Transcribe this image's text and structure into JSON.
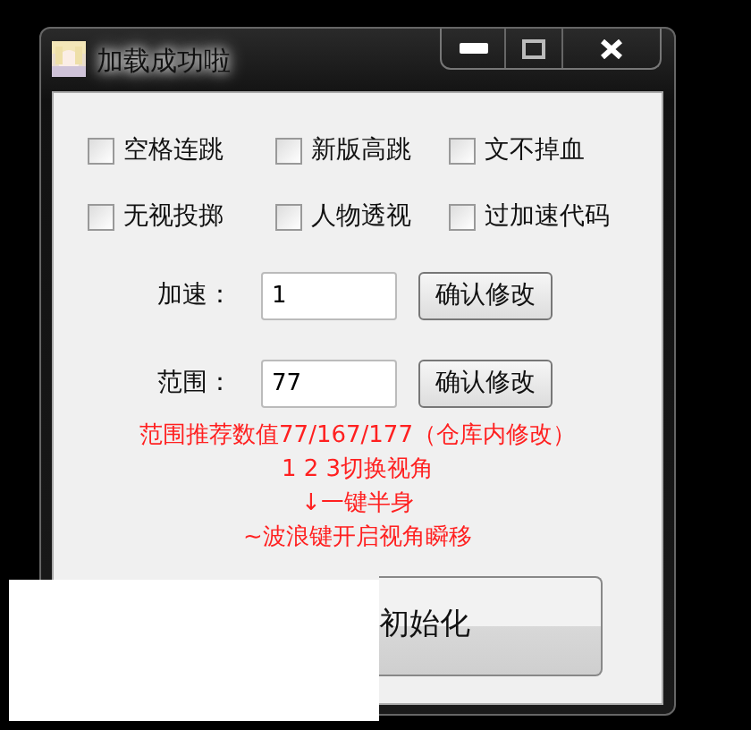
{
  "window": {
    "title": "加载成功啦"
  },
  "checkboxes": [
    {
      "label": "空格连跳",
      "checked": false
    },
    {
      "label": "新版高跳",
      "checked": false
    },
    {
      "label": "文不掉血",
      "checked": false
    },
    {
      "label": "无视投掷",
      "checked": false
    },
    {
      "label": "人物透视",
      "checked": false
    },
    {
      "label": "过加速代码",
      "checked": false
    }
  ],
  "fields": [
    {
      "label": "加速：",
      "value": "1",
      "button": "确认修改"
    },
    {
      "label": "范围：",
      "value": "77",
      "button": "确认修改"
    }
  ],
  "notes": [
    "范围推荐数值77/167/177（仓库内修改）",
    "1 2 3切换视角",
    "↓一键半身",
    "~波浪键开启视角瞬移"
  ],
  "main_button": "初始化"
}
